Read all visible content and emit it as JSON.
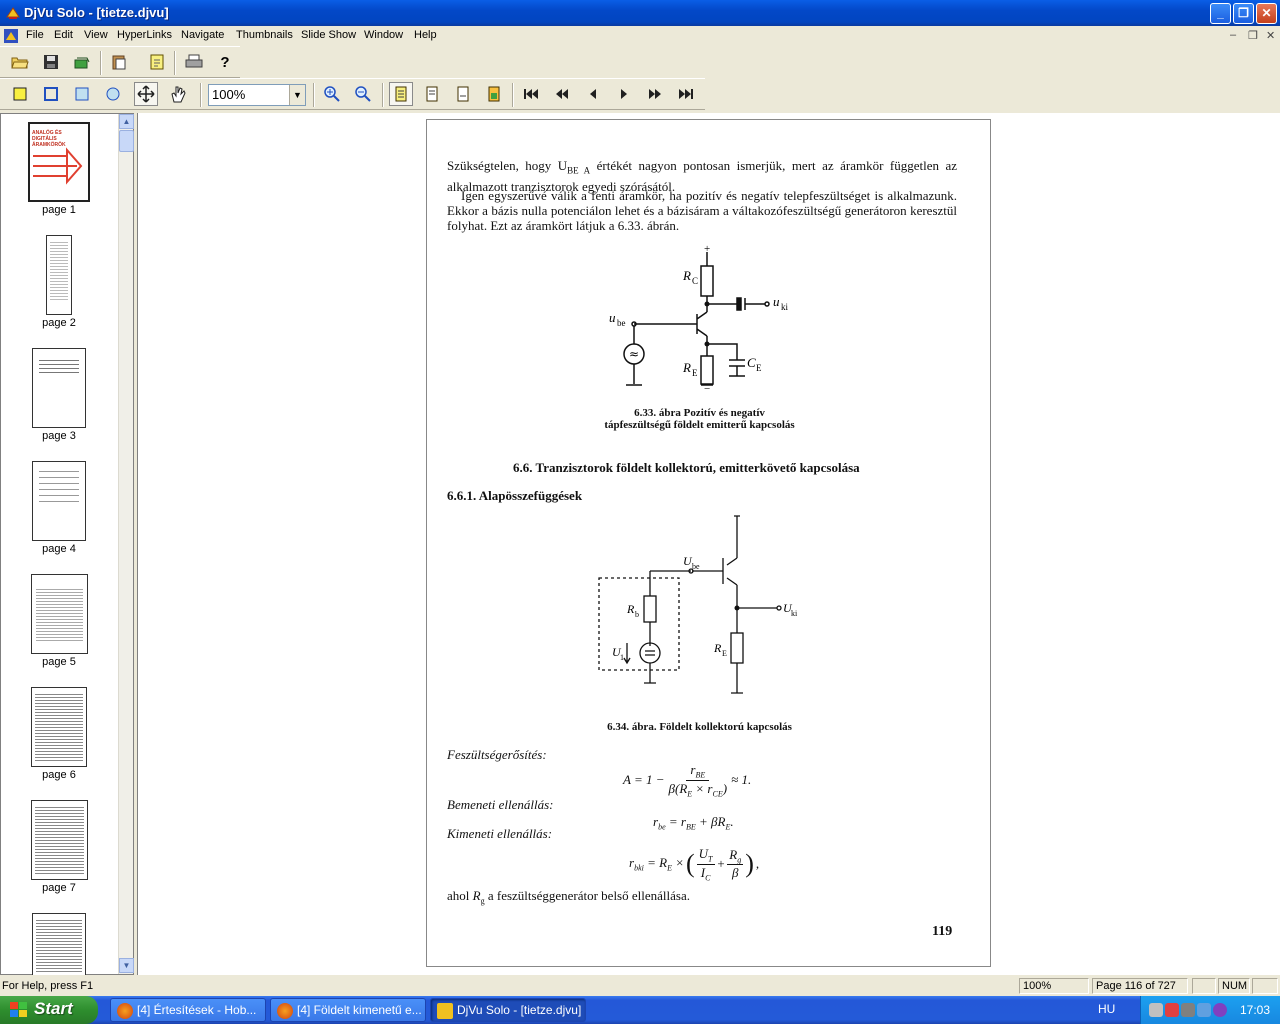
{
  "window": {
    "title": "DjVu Solo - [tietze.djvu]"
  },
  "menu": [
    "File",
    "Edit",
    "View",
    "HyperLinks",
    "Navigate",
    "Thumbnails",
    "Slide Show",
    "Window",
    "Help"
  ],
  "toolbar": {
    "zoom": "100%"
  },
  "thumbnails": [
    {
      "label": "page 1"
    },
    {
      "label": "page 2"
    },
    {
      "label": "page 3"
    },
    {
      "label": "page 4"
    },
    {
      "label": "page 5"
    },
    {
      "label": "page 6"
    },
    {
      "label": "page 7"
    }
  ],
  "thumb1_title": "ANALÓG ÉS DIGITÁLIS ÁRAMKÖRÖK",
  "document": {
    "p1a": "Szükségtelen, hogy U",
    "p1sub": "BE A",
    "p1b": " értékét nagyon pontosan ismerjük, mert az áramkör független az alkalmazott tranzisztorok egyedi szórásától.",
    "p2": "Igen egyszerűvé válik a fenti áramkör, ha pozitív és negatív telepfeszültséget is alkalmazunk. Ekkor a bázis nulla potenciálon lehet és a bázisáram a váltakozófeszültségű generátoron keresztül folyhat. Ezt az áramkört látjuk a 6.33. ábrán.",
    "fig33_caption_line1": "6.33. ábra Pozitív és negatív",
    "fig33_caption_line2": "tápfeszültségű földelt emitterű kapcsolás",
    "fig33_labels": {
      "rc": "R",
      "rc_sub": "C",
      "uki": "u",
      "uki_sub": "ki",
      "ube": "u",
      "ube_sub": "be",
      "re": "R",
      "re_sub": "E",
      "ce": "C",
      "ce_sub": "E",
      "plus": "+",
      "minus": "−"
    },
    "section_heading": "6.6.  Tranzisztorok földelt kollektorú, emitterkövető kapcsolása",
    "subsection_heading": "6.6.1.  Alapösszefüggések",
    "fig34_labels": {
      "ube": "U",
      "ube_sub": "be",
      "rb": "R",
      "rb_sub": "b",
      "u1": "U",
      "u1_sub": "1",
      "re": "R",
      "re_sub": "E",
      "uki": "U",
      "uki_sub": "ki"
    },
    "fig34_caption": "6.34. ábra. Földelt kollektorú kapcsolás",
    "label_gain": "Feszültségerősítés:",
    "label_input": "Bemeneti ellenállás:",
    "label_output": "Kimeneti ellenállás:",
    "eq_gain_lhs": "A = 1 −",
    "eq_gain_num": "r",
    "eq_gain_num_sub": "BE",
    "eq_gain_den": "β(R",
    "eq_gain_den_sub1": "E",
    "eq_gain_den_mid": " × r",
    "eq_gain_den_sub2": "CE",
    "eq_gain_den_end": ")",
    "eq_gain_rhs": "≈ 1.",
    "eq_in": "r",
    "eq_in_sub": "be",
    "eq_in_rhs1": " = r",
    "eq_in_rhs_sub1": "BE",
    "eq_in_rhs2": " + βR",
    "eq_in_rhs_sub2": "E",
    "eq_in_end": ".",
    "eq_out_lhs": "r",
    "eq_out_lhs_sub": "bki",
    "eq_out_mid": " = R",
    "eq_out_mid_sub": "E",
    "eq_out_x": " ×",
    "eq_out_f1_num": "U",
    "eq_out_f1_num_sub": "T",
    "eq_out_f1_den": "I",
    "eq_out_f1_den_sub": "C",
    "eq_out_plus": "+",
    "eq_out_f2_num": "R",
    "eq_out_f2_num_sub": "g",
    "eq_out_f2_den": "β",
    "eq_out_end": ",",
    "final_a": "ahol ",
    "final_r": "R",
    "final_r_sub": "g",
    "final_b": " a feszültséggenerátor belső ellenállása.",
    "page_number": "119"
  },
  "status": {
    "help": "For Help, press F1",
    "zoom": "100%",
    "page": "Page 116 of 727",
    "num": "NUM"
  },
  "taskbar": {
    "start": "Start",
    "tasks": [
      {
        "label": "[4] Értesítések - Hob..."
      },
      {
        "label": "[4] Földelt kimenetű e..."
      },
      {
        "label": "DjVu Solo - [tietze.djvu]"
      }
    ],
    "lang": "HU",
    "clock": "17:03"
  }
}
